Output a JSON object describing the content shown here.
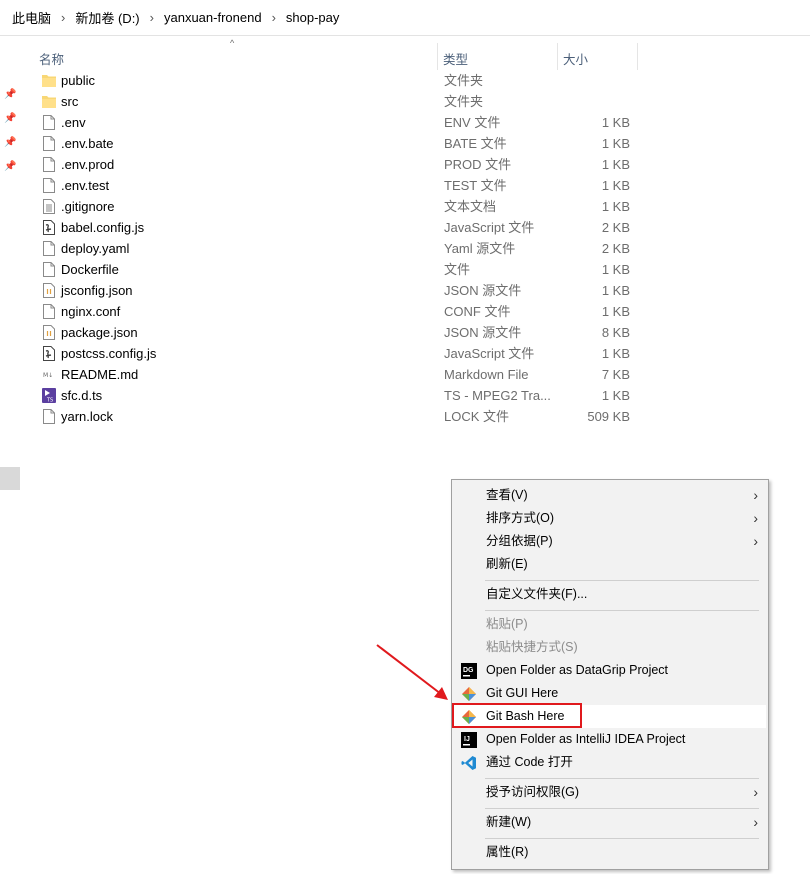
{
  "breadcrumb": [
    "此电脑",
    "新加卷 (D:)",
    "yanxuan-fronend",
    "shop-pay"
  ],
  "columns": {
    "name": "名称",
    "type": "类型",
    "size": "大小"
  },
  "files": [
    {
      "name": "public",
      "type": "文件夹",
      "size": "",
      "icon": "folder-icon"
    },
    {
      "name": "src",
      "type": "文件夹",
      "size": "",
      "icon": "folder-icon"
    },
    {
      "name": ".env",
      "type": "ENV 文件",
      "size": "1 KB",
      "icon": "file-icon"
    },
    {
      "name": ".env.bate",
      "type": "BATE 文件",
      "size": "1 KB",
      "icon": "file-icon"
    },
    {
      "name": ".env.prod",
      "type": "PROD 文件",
      "size": "1 KB",
      "icon": "file-icon"
    },
    {
      "name": ".env.test",
      "type": "TEST 文件",
      "size": "1 KB",
      "icon": "file-icon"
    },
    {
      "name": ".gitignore",
      "type": "文本文档",
      "size": "1 KB",
      "icon": "text-file-icon"
    },
    {
      "name": "babel.config.js",
      "type": "JavaScript 文件",
      "size": "2 KB",
      "icon": "script-file-icon"
    },
    {
      "name": "deploy.yaml",
      "type": "Yaml 源文件",
      "size": "2 KB",
      "icon": "file-icon"
    },
    {
      "name": "Dockerfile",
      "type": "文件",
      "size": "1 KB",
      "icon": "file-icon"
    },
    {
      "name": "jsconfig.json",
      "type": "JSON 源文件",
      "size": "1 KB",
      "icon": "json-file-icon"
    },
    {
      "name": "nginx.conf",
      "type": "CONF 文件",
      "size": "1 KB",
      "icon": "file-icon"
    },
    {
      "name": "package.json",
      "type": "JSON 源文件",
      "size": "8 KB",
      "icon": "json-file-icon"
    },
    {
      "name": "postcss.config.js",
      "type": "JavaScript 文件",
      "size": "1 KB",
      "icon": "script-file-icon"
    },
    {
      "name": "README.md",
      "type": "Markdown File",
      "size": "7 KB",
      "icon": "markdown-file-icon"
    },
    {
      "name": "sfc.d.ts",
      "type": "TS - MPEG2 Tra...",
      "size": "1 KB",
      "icon": "ts-file-icon"
    },
    {
      "name": "yarn.lock",
      "type": "LOCK 文件",
      "size": "509 KB",
      "icon": "file-icon"
    }
  ],
  "context_menu": {
    "view": "查看(V)",
    "sort": "排序方式(O)",
    "group": "分组依据(P)",
    "refresh": "刷新(E)",
    "customize": "自定义文件夹(F)...",
    "paste": "粘贴(P)",
    "paste_shortcut": "粘贴快捷方式(S)",
    "datagrip": "Open Folder as DataGrip Project",
    "datagrip_badge": "DG",
    "git_gui": "Git GUI Here",
    "git_bash": "Git Bash Here",
    "intellij": "Open Folder as IntelliJ IDEA Project",
    "intellij_badge": "IJ",
    "vscode": "通过 Code 打开",
    "grant_access": "授予访问权限(G)",
    "new": "新建(W)",
    "properties": "属性(R)"
  },
  "colors": {
    "highlight_border": "#e0191d",
    "arrow": "#e0191d",
    "folder": "#f8d775",
    "header_text": "#4c607a"
  }
}
